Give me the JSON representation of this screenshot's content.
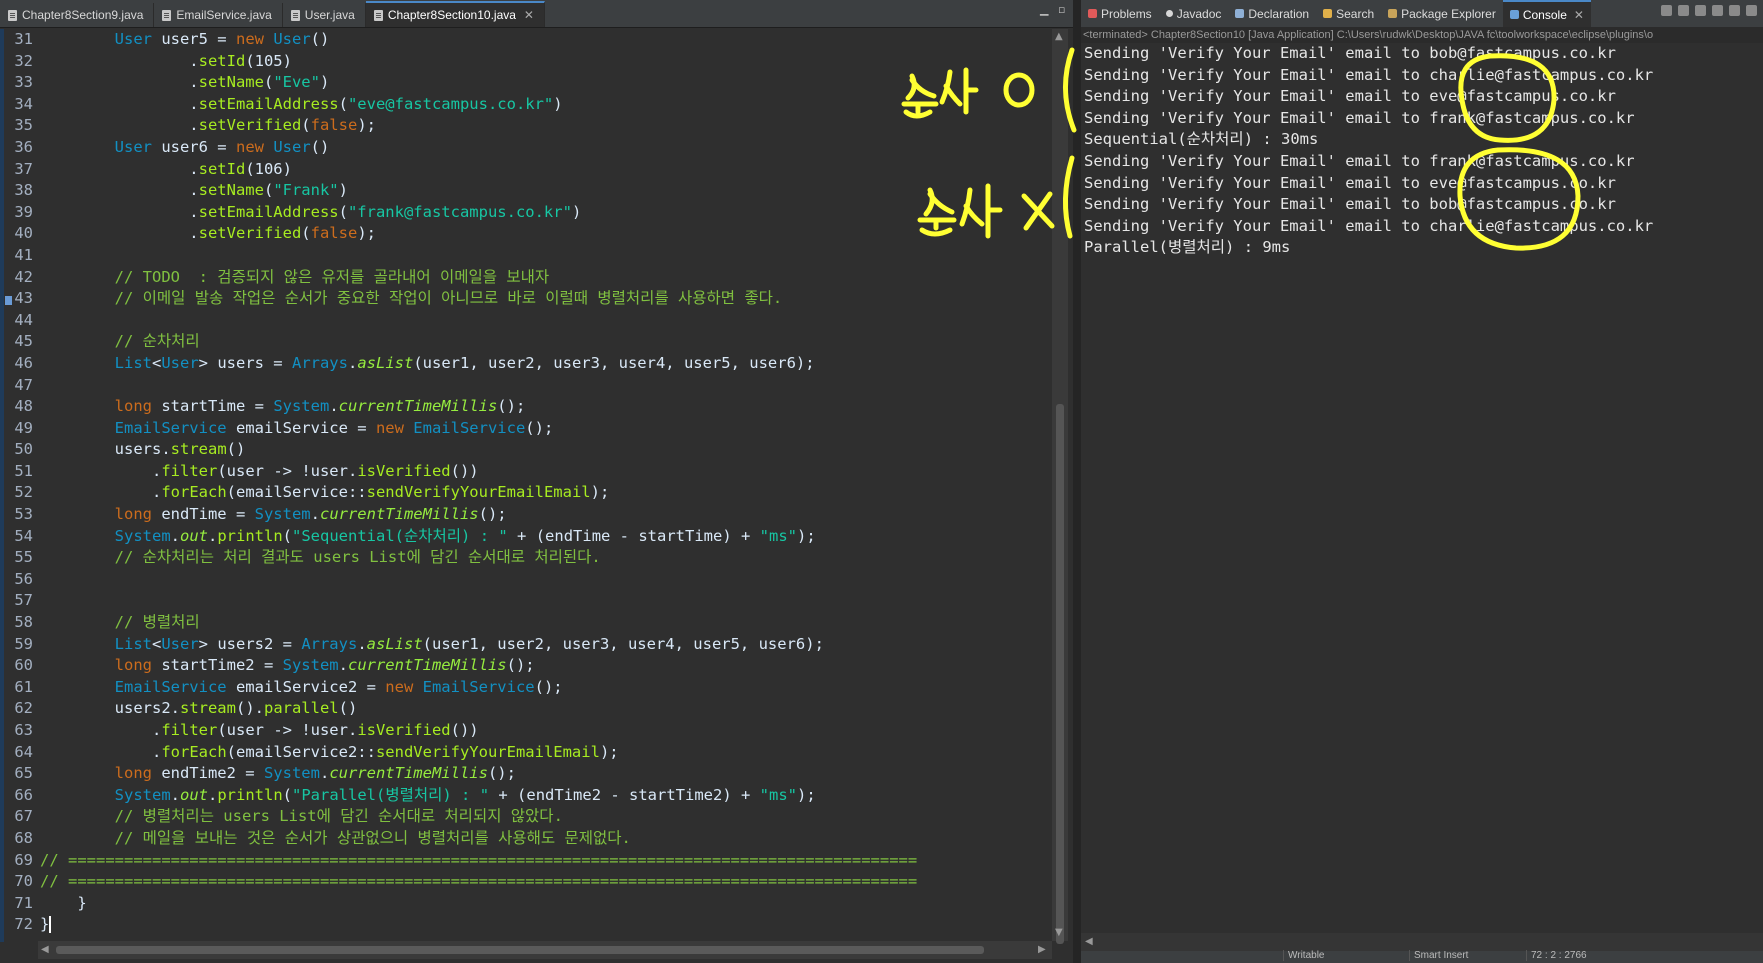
{
  "editor": {
    "tabs": [
      {
        "label": "Chapter8Section9.java",
        "active": false
      },
      {
        "label": "EmailService.java",
        "active": false
      },
      {
        "label": "User.java",
        "active": false
      },
      {
        "label": "Chapter8Section10.java",
        "active": true
      }
    ],
    "code_lines": [
      {
        "n": "31",
        "segs": [
          [
            "pl",
            "        "
          ],
          [
            "ty",
            "User"
          ],
          [
            "pl",
            " user5 = "
          ],
          [
            "kw",
            "new"
          ],
          [
            "pl",
            " "
          ],
          [
            "ty",
            "User"
          ],
          [
            "pl",
            "()"
          ]
        ]
      },
      {
        "n": "32",
        "segs": [
          [
            "pl",
            "                ."
          ],
          [
            "mt",
            "setId"
          ],
          [
            "pl",
            "(105)"
          ]
        ]
      },
      {
        "n": "33",
        "segs": [
          [
            "pl",
            "                ."
          ],
          [
            "mt",
            "setName"
          ],
          [
            "pl",
            "("
          ],
          [
            "str",
            "\"Eve\""
          ],
          [
            "pl",
            ")"
          ]
        ]
      },
      {
        "n": "34",
        "segs": [
          [
            "pl",
            "                ."
          ],
          [
            "mt",
            "setEmailAddress"
          ],
          [
            "pl",
            "("
          ],
          [
            "str",
            "\"eve@fastcampus.co.kr\""
          ],
          [
            "pl",
            ")"
          ]
        ]
      },
      {
        "n": "35",
        "segs": [
          [
            "pl",
            "                ."
          ],
          [
            "mt",
            "setVerified"
          ],
          [
            "pl",
            "("
          ],
          [
            "kw",
            "false"
          ],
          [
            "pl",
            ");"
          ]
        ]
      },
      {
        "n": "36",
        "segs": [
          [
            "pl",
            "        "
          ],
          [
            "ty",
            "User"
          ],
          [
            "pl",
            " user6 = "
          ],
          [
            "kw",
            "new"
          ],
          [
            "pl",
            " "
          ],
          [
            "ty",
            "User"
          ],
          [
            "pl",
            "()"
          ]
        ]
      },
      {
        "n": "37",
        "segs": [
          [
            "pl",
            "                ."
          ],
          [
            "mt",
            "setId"
          ],
          [
            "pl",
            "(106)"
          ]
        ]
      },
      {
        "n": "38",
        "segs": [
          [
            "pl",
            "                ."
          ],
          [
            "mt",
            "setName"
          ],
          [
            "pl",
            "("
          ],
          [
            "str",
            "\"Frank\""
          ],
          [
            "pl",
            ")"
          ]
        ]
      },
      {
        "n": "39",
        "segs": [
          [
            "pl",
            "                ."
          ],
          [
            "mt",
            "setEmailAddress"
          ],
          [
            "pl",
            "("
          ],
          [
            "str",
            "\"frank@fastcampus.co.kr\""
          ],
          [
            "pl",
            ")"
          ]
        ]
      },
      {
        "n": "40",
        "segs": [
          [
            "pl",
            "                ."
          ],
          [
            "mt",
            "setVerified"
          ],
          [
            "pl",
            "("
          ],
          [
            "kw",
            "false"
          ],
          [
            "pl",
            ");"
          ]
        ]
      },
      {
        "n": "41",
        "segs": [
          [
            "pl",
            ""
          ]
        ]
      },
      {
        "n": "42",
        "segs": [
          [
            "pl",
            "        "
          ],
          [
            "cm",
            "// TODO  : 검증되지 않은 유저를 골라내어 이메일을 보내자"
          ]
        ]
      },
      {
        "n": "43",
        "segs": [
          [
            "pl",
            "        "
          ],
          [
            "cm",
            "// 이메일 발송 작업은 순서가 중요한 작업이 아니므로 바로 이럴때 병렬처리를 사용하면 좋다."
          ]
        ]
      },
      {
        "n": "44",
        "segs": [
          [
            "pl",
            ""
          ]
        ]
      },
      {
        "n": "45",
        "segs": [
          [
            "pl",
            "        "
          ],
          [
            "cm",
            "// 순차처리"
          ]
        ]
      },
      {
        "n": "46",
        "segs": [
          [
            "pl",
            "        "
          ],
          [
            "ty",
            "List"
          ],
          [
            "pl",
            "<"
          ],
          [
            "ty",
            "User"
          ],
          [
            "pl",
            "> users = "
          ],
          [
            "ty",
            "Arrays"
          ],
          [
            "pl",
            "."
          ],
          [
            "st",
            "asList"
          ],
          [
            "pl",
            "(user1, user2, user3, user4, user5, user6);"
          ]
        ]
      },
      {
        "n": "47",
        "segs": [
          [
            "pl",
            ""
          ]
        ]
      },
      {
        "n": "48",
        "segs": [
          [
            "pl",
            "        "
          ],
          [
            "kw",
            "long"
          ],
          [
            "pl",
            " startTime = "
          ],
          [
            "ty",
            "System"
          ],
          [
            "pl",
            "."
          ],
          [
            "st",
            "currentTimeMillis"
          ],
          [
            "pl",
            "();"
          ]
        ]
      },
      {
        "n": "49",
        "segs": [
          [
            "pl",
            "        "
          ],
          [
            "ty",
            "EmailService"
          ],
          [
            "pl",
            " emailService = "
          ],
          [
            "kw",
            "new"
          ],
          [
            "pl",
            " "
          ],
          [
            "ty",
            "EmailService"
          ],
          [
            "pl",
            "();"
          ]
        ]
      },
      {
        "n": "50",
        "segs": [
          [
            "pl",
            "        users."
          ],
          [
            "mt",
            "stream"
          ],
          [
            "pl",
            "()"
          ]
        ]
      },
      {
        "n": "51",
        "segs": [
          [
            "pl",
            "            ."
          ],
          [
            "mt",
            "filter"
          ],
          [
            "pl",
            "(user -> !user."
          ],
          [
            "mt",
            "isVerified"
          ],
          [
            "pl",
            "())"
          ]
        ]
      },
      {
        "n": "52",
        "segs": [
          [
            "pl",
            "            ."
          ],
          [
            "mt",
            "forEach"
          ],
          [
            "pl",
            "(emailService::"
          ],
          [
            "mt",
            "sendVerifyYourEmailEmail"
          ],
          [
            "pl",
            ");"
          ]
        ]
      },
      {
        "n": "53",
        "segs": [
          [
            "pl",
            "        "
          ],
          [
            "kw",
            "long"
          ],
          [
            "pl",
            " endTime = "
          ],
          [
            "ty",
            "System"
          ],
          [
            "pl",
            "."
          ],
          [
            "st",
            "currentTimeMillis"
          ],
          [
            "pl",
            "();"
          ]
        ]
      },
      {
        "n": "54",
        "segs": [
          [
            "pl",
            "        "
          ],
          [
            "ty",
            "System"
          ],
          [
            "pl",
            "."
          ],
          [
            "st",
            "out"
          ],
          [
            "pl",
            "."
          ],
          [
            "mt",
            "println"
          ],
          [
            "pl",
            "("
          ],
          [
            "str",
            "\"Sequential(순차처리) : \""
          ],
          [
            "pl",
            " + (endTime - startTime) + "
          ],
          [
            "str",
            "\"ms\""
          ],
          [
            "pl",
            ");"
          ]
        ]
      },
      {
        "n": "55",
        "segs": [
          [
            "pl",
            "        "
          ],
          [
            "cm",
            "// 순차처리는 처리 결과도 users List에 담긴 순서대로 처리된다."
          ]
        ]
      },
      {
        "n": "56",
        "segs": [
          [
            "pl",
            ""
          ]
        ]
      },
      {
        "n": "57",
        "segs": [
          [
            "pl",
            ""
          ]
        ]
      },
      {
        "n": "58",
        "segs": [
          [
            "pl",
            "        "
          ],
          [
            "cm",
            "// 병렬처리"
          ]
        ]
      },
      {
        "n": "59",
        "segs": [
          [
            "pl",
            "        "
          ],
          [
            "ty",
            "List"
          ],
          [
            "pl",
            "<"
          ],
          [
            "ty",
            "User"
          ],
          [
            "pl",
            "> users2 = "
          ],
          [
            "ty",
            "Arrays"
          ],
          [
            "pl",
            "."
          ],
          [
            "st",
            "asList"
          ],
          [
            "pl",
            "(user1, user2, user3, user4, user5, user6);"
          ]
        ]
      },
      {
        "n": "60",
        "segs": [
          [
            "pl",
            "        "
          ],
          [
            "kw",
            "long"
          ],
          [
            "pl",
            " startTime2 = "
          ],
          [
            "ty",
            "System"
          ],
          [
            "pl",
            "."
          ],
          [
            "st",
            "currentTimeMillis"
          ],
          [
            "pl",
            "();"
          ]
        ]
      },
      {
        "n": "61",
        "segs": [
          [
            "pl",
            "        "
          ],
          [
            "ty",
            "EmailService"
          ],
          [
            "pl",
            " emailService2 = "
          ],
          [
            "kw",
            "new"
          ],
          [
            "pl",
            " "
          ],
          [
            "ty",
            "EmailService"
          ],
          [
            "pl",
            "();"
          ]
        ]
      },
      {
        "n": "62",
        "segs": [
          [
            "pl",
            "        users2."
          ],
          [
            "mt",
            "stream"
          ],
          [
            "pl",
            "()."
          ],
          [
            "mt",
            "parallel"
          ],
          [
            "pl",
            "()"
          ]
        ]
      },
      {
        "n": "63",
        "segs": [
          [
            "pl",
            "            ."
          ],
          [
            "mt",
            "filter"
          ],
          [
            "pl",
            "(user -> !user."
          ],
          [
            "mt",
            "isVerified"
          ],
          [
            "pl",
            "())"
          ]
        ]
      },
      {
        "n": "64",
        "segs": [
          [
            "pl",
            "            ."
          ],
          [
            "mt",
            "forEach"
          ],
          [
            "pl",
            "(emailService2::"
          ],
          [
            "mt",
            "sendVerifyYourEmailEmail"
          ],
          [
            "pl",
            ");"
          ]
        ]
      },
      {
        "n": "65",
        "segs": [
          [
            "pl",
            "        "
          ],
          [
            "kw",
            "long"
          ],
          [
            "pl",
            " endTime2 = "
          ],
          [
            "ty",
            "System"
          ],
          [
            "pl",
            "."
          ],
          [
            "st",
            "currentTimeMillis"
          ],
          [
            "pl",
            "();"
          ]
        ]
      },
      {
        "n": "66",
        "segs": [
          [
            "pl",
            "        "
          ],
          [
            "ty",
            "System"
          ],
          [
            "pl",
            "."
          ],
          [
            "st",
            "out"
          ],
          [
            "pl",
            "."
          ],
          [
            "mt",
            "println"
          ],
          [
            "pl",
            "("
          ],
          [
            "str",
            "\"Parallel(병렬처리) : \""
          ],
          [
            "pl",
            " + (endTime2 - startTime2) + "
          ],
          [
            "str",
            "\"ms\""
          ],
          [
            "pl",
            ");"
          ]
        ]
      },
      {
        "n": "67",
        "segs": [
          [
            "pl",
            "        "
          ],
          [
            "cm",
            "// 병렬처리는 users List에 담긴 순서대로 처리되지 않았다."
          ]
        ]
      },
      {
        "n": "68",
        "segs": [
          [
            "pl",
            "        "
          ],
          [
            "cm",
            "// 메일을 보내는 것은 순서가 상관없으니 병렬처리를 사용해도 문제없다."
          ]
        ]
      },
      {
        "n": "69",
        "segs": [
          [
            "cm",
            "// ==========================================================================================="
          ]
        ]
      },
      {
        "n": "70",
        "segs": [
          [
            "cm",
            "// ==========================================================================================="
          ]
        ]
      },
      {
        "n": "71",
        "segs": [
          [
            "pl",
            "    }"
          ]
        ]
      },
      {
        "n": "72",
        "segs": [
          [
            "pl",
            "}"
          ]
        ],
        "cursor": true
      }
    ]
  },
  "console_panel": {
    "tabs": [
      {
        "label": "Problems",
        "active": false,
        "icon_color": "#e05a5a",
        "icon": "problems-icon"
      },
      {
        "label": "Javadoc",
        "active": false,
        "icon_color": "#d7d7d7",
        "icon": "javadoc-icon"
      },
      {
        "label": "Declaration",
        "active": false,
        "icon_color": "#8fb0d6",
        "icon": "declaration-icon"
      },
      {
        "label": "Search",
        "active": false,
        "icon_color": "#e0b04a",
        "icon": "search-icon"
      },
      {
        "label": "Package Explorer",
        "active": false,
        "icon_color": "#c8a45a",
        "icon": "package-explorer-icon"
      },
      {
        "label": "Console",
        "active": true,
        "icon_color": "#6aa0d8",
        "icon": "console-icon"
      }
    ],
    "terminated": "<terminated> Chapter8Section10 [Java Application] C:\\Users\\rudwk\\Desktop\\JAVA fc\\toolworkspace\\eclipse\\plugins\\o",
    "output": [
      "Sending 'Verify Your Email' email to bob@fastcampus.co.kr",
      "Sending 'Verify Your Email' email to charlie@fastcampus.co.kr",
      "Sending 'Verify Your Email' email to eve@fastcampus.co.kr",
      "Sending 'Verify Your Email' email to frank@fastcampus.co.kr",
      "Sequential(순차처리) : 30ms",
      "Sending 'Verify Your Email' email to frank@fastcampus.co.kr",
      "Sending 'Verify Your Email' email to eve@fastcampus.co.kr",
      "Sending 'Verify Your Email' email to bob@fastcampus.co.kr",
      "Sending 'Verify Your Email' email to charlie@fastcampus.co.kr",
      "Parallel(병렬처리) : 9ms"
    ]
  },
  "status_bar": {
    "writable": "Writable",
    "insert_mode": "Smart Insert",
    "position": "72 : 2 : 2766"
  },
  "annotations": {
    "ordered_label": "순서 O",
    "unordered_label": "순서 X",
    "ink_color": "#ffff33"
  },
  "colors": {
    "editor_bg": "#2f2f2f",
    "keyword": "#cc6c1d",
    "type": "#1290c3",
    "string": "#17c6a3",
    "comment": "#80c040",
    "method": "#a7ec21",
    "static": "#96ec3f"
  }
}
